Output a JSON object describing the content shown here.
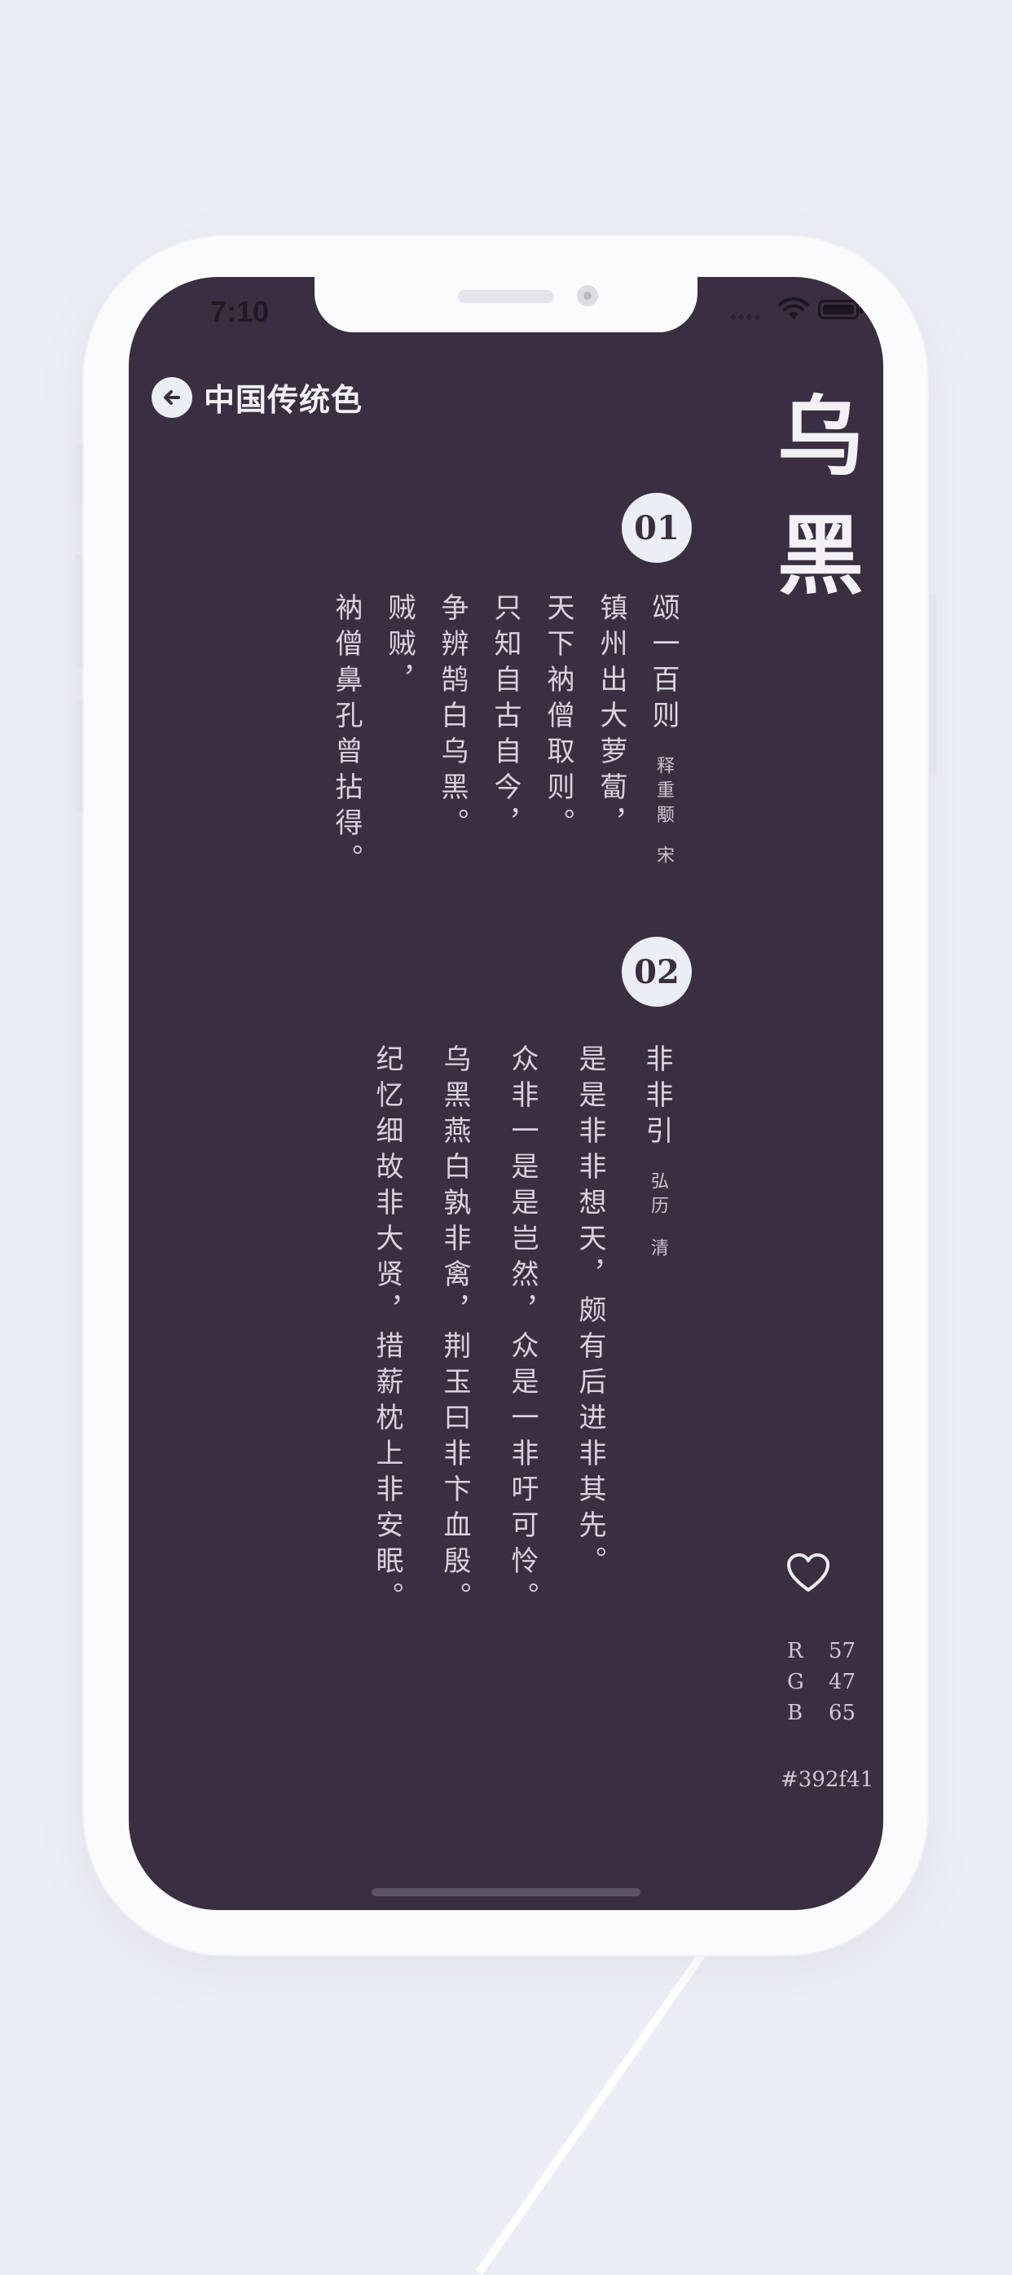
{
  "status_bar": {
    "time": "7:10"
  },
  "header": {
    "title": "中国传统色"
  },
  "color": {
    "name": "乌黑",
    "hex": "#392f41",
    "r": "57",
    "g": "47",
    "b": "65",
    "r_label": "R",
    "g_label": "G",
    "b_label": "B"
  },
  "icons": {
    "back": "arrow-left-icon",
    "favorite": "heart-icon",
    "wifi": "wifi-icon",
    "battery": "battery-icon"
  },
  "poems": [
    {
      "number": "01",
      "title": "颂一百则",
      "author": "释重颙",
      "dynasty": "宋",
      "lines": [
        "镇州出大萝蔔，",
        "天下衲僧取则。",
        "只知自古自今，",
        "争辨鹄白乌黑。",
        "贼贼，",
        "衲僧鼻孔曾拈得。"
      ]
    },
    {
      "number": "02",
      "title": "非非引",
      "author": "弘历",
      "dynasty": "清",
      "lines": [
        "是是非非想天，颇有后进非其先。",
        "众非一是是岂然，众是一非吁可怜。",
        "乌黑燕白孰非禽，荆玉曰非卞血殷。",
        "纪忆细故非大贤，措薪枕上非安眠。"
      ]
    }
  ]
}
